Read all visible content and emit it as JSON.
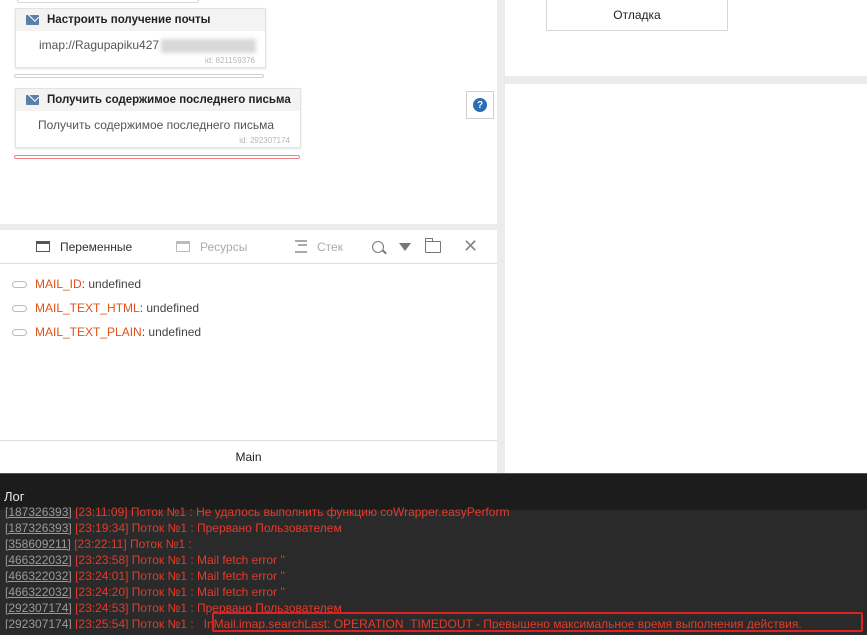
{
  "blocks": [
    {
      "title": "Настроить получение почты",
      "body": "imap://Ragupapiku427",
      "id_label": "id: 821159376"
    },
    {
      "title": "Получить содержимое последнего письма",
      "body": "Получить содержимое последнего письма",
      "id_label": "id: 292307174"
    }
  ],
  "right_panel": {
    "debug_label": "Отладка",
    "help_label": "?"
  },
  "variables_panel": {
    "tabs": [
      {
        "label": "Переменные",
        "icon": "calendar-icon"
      },
      {
        "label": "Ресурсы",
        "icon": "resources-icon"
      },
      {
        "label": "Стек",
        "icon": "stack-icon"
      }
    ],
    "tools": [
      "search-icon",
      "filter-icon",
      "folder-icon",
      "close-icon"
    ],
    "items": [
      {
        "name": "MAIL_ID",
        "value": "undefined"
      },
      {
        "name": "MAIL_TEXT_HTML",
        "value": "undefined"
      },
      {
        "name": "MAIL_TEXT_PLAIN",
        "value": "undefined"
      }
    ],
    "footer": "Main"
  },
  "log": {
    "title": "Лог",
    "lines": [
      {
        "id": "[187326393]",
        "text": "[23:11:09] Поток №1 : Не удалось выполнить функцию coWrapper.easyPerform"
      },
      {
        "id": "[187326393]",
        "text": "[23:19:34] Поток №1 : Прервано Пользователем"
      },
      {
        "id": "[358609211]",
        "text": "[23:22:11] Поток №1 :"
      },
      {
        "id": "[466322032]",
        "text": "[23:23:58] Поток №1 : Mail fetch error ''"
      },
      {
        "id": "[466322032]",
        "text": "[23:24:01] Поток №1 : Mail fetch error ''"
      },
      {
        "id": "[466322032]",
        "text": "[23:24:20] Поток №1 : Mail fetch error ''"
      },
      {
        "id": "[292307174]",
        "text": "[23:24:53] Поток №1 : Прервано Пользователем"
      },
      {
        "id": "[292307174]",
        "text": "[23:25:54] Поток №1 : _InMail.imap.searchLast: OPERATION_TIMEDOUT - Превышено максимальное время выполнения действия."
      }
    ]
  },
  "colors": {
    "accent_orange": "#e0531a",
    "log_red": "#e23b2c",
    "highlight": "#e02020",
    "help_blue": "#2a6fb5"
  }
}
